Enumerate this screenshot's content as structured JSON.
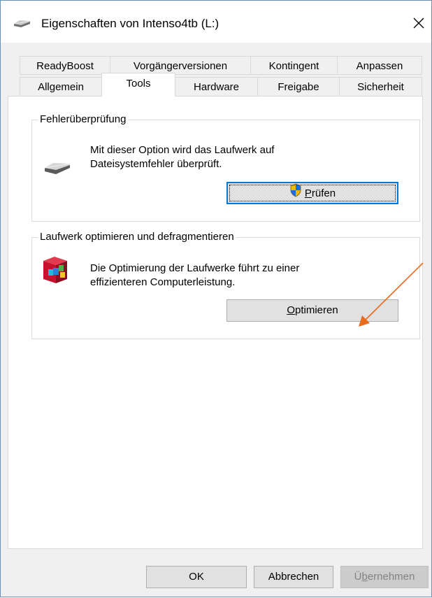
{
  "window": {
    "title": "Eigenschaften von Intenso4tb (L:)",
    "icon": "drive-icon",
    "close_glyph": "✕"
  },
  "tabs": {
    "row1": [
      "ReadyBoost",
      "Vorgängerversionen",
      "Kontingent",
      "Anpassen"
    ],
    "row2": [
      "Allgemein",
      "Tools",
      "Hardware",
      "Freigabe",
      "Sicherheit"
    ],
    "active": "Tools"
  },
  "error_check": {
    "title": "Fehlerüberprüfung",
    "desc_line1": "Mit dieser Option wird das Laufwerk auf",
    "desc_line2": "Dateisystemfehler überprüft.",
    "button": {
      "accel": "P",
      "rest": "rüfen",
      "icon": "uac-shield-icon"
    }
  },
  "optimize": {
    "title": "Laufwerk optimieren und defragmentieren",
    "desc_line1": "Die Optimierung der Laufwerke führt zu einer",
    "desc_line2": "effizienteren Computerleistung.",
    "button": {
      "accel": "O",
      "rest": "ptimieren",
      "icon": "defrag-icon"
    }
  },
  "footer": {
    "ok": "OK",
    "cancel": "Abbrechen",
    "apply": {
      "pre": "Ü",
      "accel": "b",
      "rest": "ernehmen"
    }
  },
  "annotation": {
    "color": "#e86a1c",
    "target": "optimize-button"
  }
}
